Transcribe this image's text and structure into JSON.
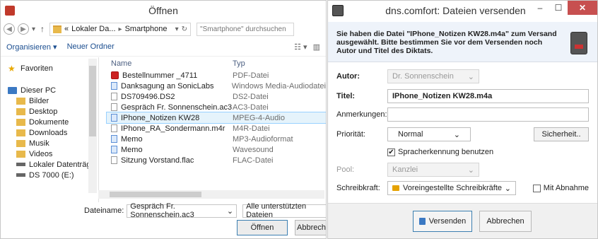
{
  "open_dialog": {
    "title": "Öffnen",
    "breadcrumb": [
      "«",
      "Lokaler Da...",
      "Smartphone"
    ],
    "search_placeholder": "\"Smartphone\" durchsuchen",
    "toolbar": {
      "organize": "Organisieren ▾",
      "new_folder": "Neuer Ordner"
    },
    "nav": {
      "favorites": "Favoriten",
      "this_pc": "Dieser PC",
      "items": [
        "Bilder",
        "Desktop",
        "Dokumente",
        "Downloads",
        "Musik",
        "Videos",
        "Lokaler Datenträg",
        "DS 7000 (E:)"
      ]
    },
    "columns": {
      "name": "Name",
      "type": "Typ"
    },
    "files": [
      {
        "name": "Bestellnummer _4711",
        "type": "PDF-Datei",
        "icon": "pdf-icon"
      },
      {
        "name": "Danksagung an SonicLabs",
        "type": "Windows Media-Audiodatei",
        "icon": "audio-icon"
      },
      {
        "name": "DS709496.DS2",
        "type": "DS2-Datei",
        "icon": "file-icon"
      },
      {
        "name": "Gespräch Fr. Sonnenschein.ac3",
        "type": "AC3-Datei",
        "icon": "file-icon"
      },
      {
        "name": "IPhone_Notizen KW28",
        "type": "MPEG-4-Audio",
        "icon": "audio-icon"
      },
      {
        "name": "IPhone_RA_Sondermann.m4r",
        "type": "M4R-Datei",
        "icon": "file-icon"
      },
      {
        "name": "Memo",
        "type": "MP3-Audioformat",
        "icon": "audio-icon"
      },
      {
        "name": "Memo",
        "type": "Wavesound",
        "icon": "audio-icon"
      },
      {
        "name": "Sitzung Vorstand.flac",
        "type": "FLAC-Datei",
        "icon": "file-icon"
      }
    ],
    "selected_index": 4,
    "filename_label": "Dateiname:",
    "filename_value": "Gespräch Fr. Sonnenschein.ac3",
    "filter_value": "Alle unterstützten Dateien",
    "open_button": "Öffnen",
    "cancel_button": "Abbrech"
  },
  "send_dialog": {
    "title": "dns.comfort: Dateien versenden",
    "banner_text": "Sie haben die Datei \"IPhone_Notizen KW28.m4a\" zum Versand ausgewählt. Bitte bestimmen Sie vor dem Versenden noch Autor und Titel des Diktats.",
    "fields": {
      "author_label": "Autor:",
      "author_value": "Dr. Sonnenschein",
      "title_label": "Titel:",
      "title_value": "IPhone_Notizen KW28.m4a",
      "remarks_label": "Anmerkungen:",
      "remarks_value": "",
      "priority_label": "Priorität:",
      "priority_value": "Normal",
      "security_button": "Sicherheit..",
      "speech_recognition_label": "Spracherkennung benutzen",
      "pool_label": "Pool:",
      "pool_value": "Kanzlei",
      "typist_label": "Schreibkraft:",
      "typist_value": "Voreingestellte Schreibkräfte",
      "acceptance_label": "Mit Abnahme"
    },
    "speech_recognition_checked": true,
    "acceptance_checked": false,
    "send_button": "Versenden",
    "cancel_button": "Abbrechen"
  }
}
